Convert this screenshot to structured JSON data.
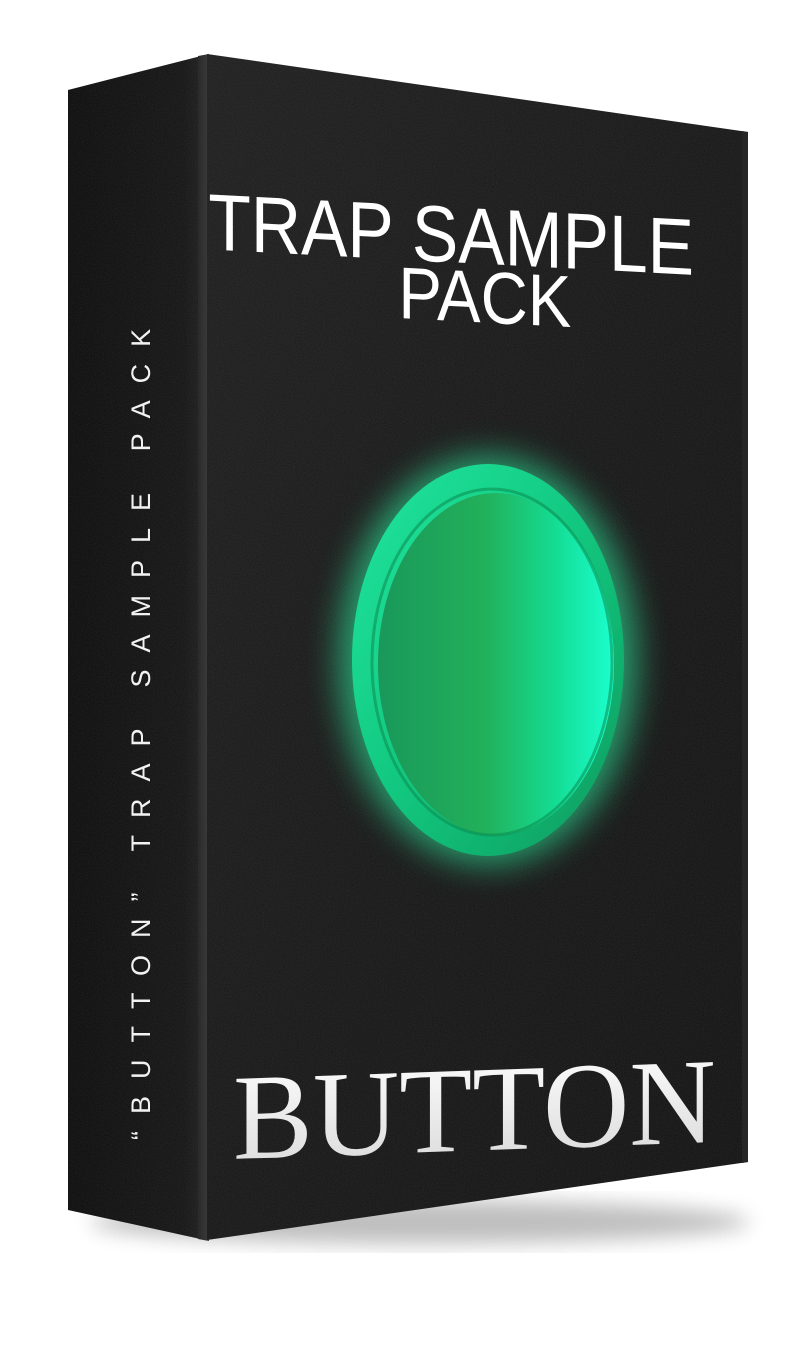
{
  "product": {
    "title_line1": "TRAP SAMPLE",
    "title_line2": "PACK",
    "name": "BUTTON",
    "spine_text": "“BUTTON” TRAP SAMPLE PACK"
  },
  "colors": {
    "background": "#ffffff",
    "box_face": "#161616",
    "box_spine": "#0c0c0c",
    "button_glow": "#3dffb0",
    "button_ring": "#15b86a",
    "button_left": "#1fa85f",
    "button_right": "#18f5c4",
    "text": "#ffffff"
  },
  "icons": {
    "center_graphic": "glowing-green-button-icon"
  }
}
